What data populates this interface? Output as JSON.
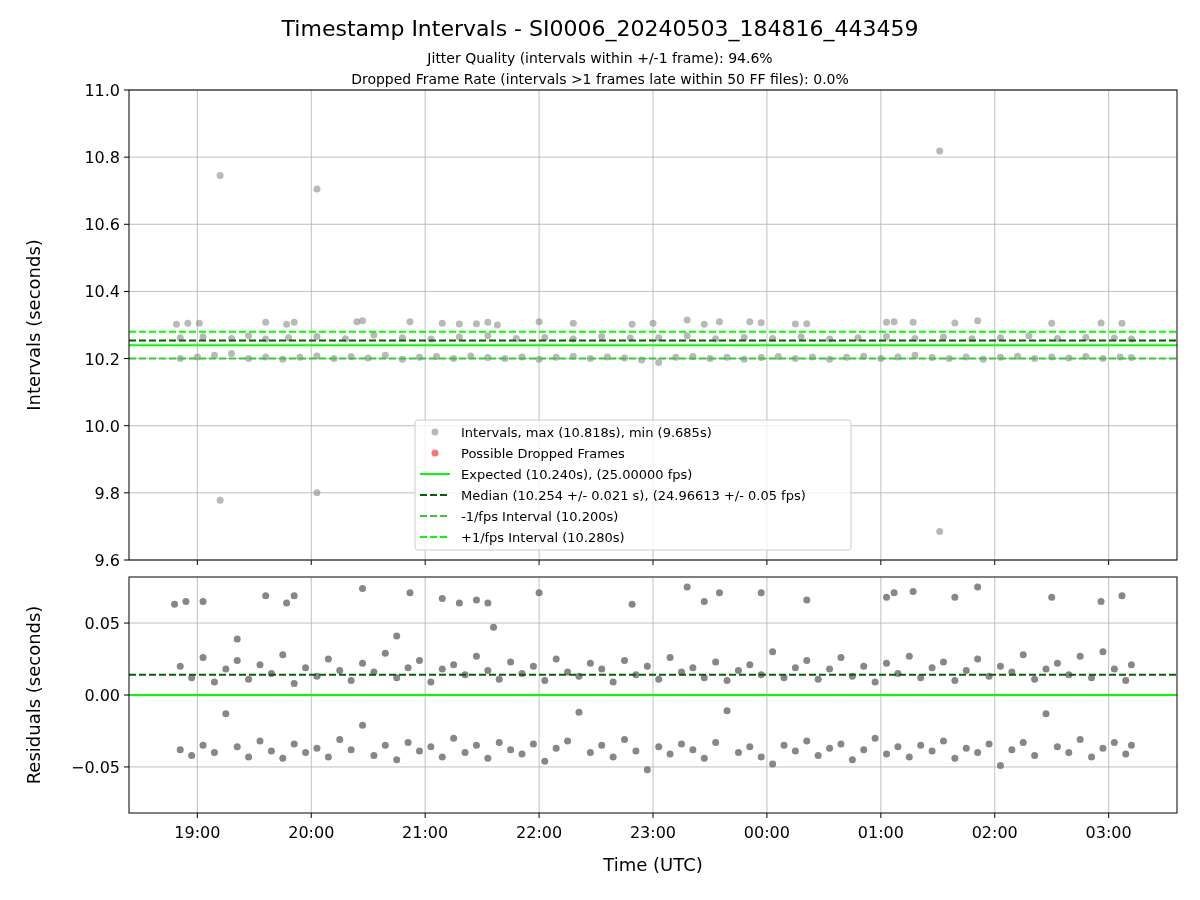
{
  "title": "Timestamp Intervals - SI0006_20240503_184816_443459",
  "subtitles": [
    "Jitter Quality (intervals within +/-1 frame): 94.6%",
    "Dropped Frame Rate (intervals >1 frames late within 50 FF files): 0.0%"
  ],
  "charts": [
    {
      "chart_data": {
        "type": "scatter",
        "ylabel": "Intervals (seconds)",
        "xlim": [
          "2024-05-03T18:24",
          "2024-05-04T03:36"
        ],
        "ylim": [
          9.6,
          11.0
        ],
        "grid": true,
        "legend": "lower center",
        "yticks": [
          {
            "value": 9.6,
            "label": "9.6"
          },
          {
            "value": 9.8,
            "label": "9.8"
          },
          {
            "value": 10.0,
            "label": "10.0"
          },
          {
            "value": 10.2,
            "label": "10.2"
          },
          {
            "value": 10.4,
            "label": "10.4"
          },
          {
            "value": 10.6,
            "label": "10.6"
          },
          {
            "value": 10.8,
            "label": "10.8"
          },
          {
            "value": 11.0,
            "label": "11.0"
          }
        ],
        "series": [
          {
            "name": "Intervals, max (10.818s), min (9.685s)",
            "color": "#808080",
            "x": [
              "2024-05-03T19:12",
              "2024-05-03T20:03",
              "2024-05-04T01:31",
              "2024-05-03T19:12",
              "2024-05-03T20:03",
              "2024-05-04T01:31",
              "2024-05-03T18:49",
              "2024-05-03T18:55",
              "2024-05-03T19:01",
              "2024-05-03T19:36",
              "2024-05-03T19:47",
              "2024-05-03T19:51",
              "2024-05-03T20:24",
              "2024-05-03T20:27",
              "2024-05-03T20:52",
              "2024-05-03T21:09",
              "2024-05-03T21:18",
              "2024-05-03T21:27",
              "2024-05-03T21:33",
              "2024-05-03T21:38",
              "2024-05-03T22:00",
              "2024-05-03T22:18",
              "2024-05-03T22:49",
              "2024-05-03T23:00",
              "2024-05-03T23:18",
              "2024-05-03T23:27",
              "2024-05-03T23:35",
              "2024-05-03T23:51",
              "2024-05-03T23:57",
              "2024-05-04T00:15",
              "2024-05-04T00:21",
              "2024-05-04T01:03",
              "2024-05-04T01:07",
              "2024-05-04T01:17",
              "2024-05-04T01:39",
              "2024-05-04T01:51",
              "2024-05-04T02:30",
              "2024-05-04T02:56",
              "2024-05-04T03:07",
              "2024-05-03T18:51",
              "2024-05-03T19:03",
              "2024-05-03T19:18",
              "2024-05-03T19:27",
              "2024-05-03T19:36",
              "2024-05-03T19:48",
              "2024-05-03T20:03",
              "2024-05-03T20:18",
              "2024-05-03T20:33",
              "2024-05-03T20:48",
              "2024-05-03T21:03",
              "2024-05-03T21:18",
              "2024-05-03T21:33",
              "2024-05-03T21:48",
              "2024-05-03T22:03",
              "2024-05-03T22:18",
              "2024-05-03T22:33",
              "2024-05-03T22:48",
              "2024-05-03T23:03",
              "2024-05-03T23:18",
              "2024-05-03T23:33",
              "2024-05-03T23:48",
              "2024-05-04T00:03",
              "2024-05-04T00:18",
              "2024-05-04T00:33",
              "2024-05-04T00:48",
              "2024-05-04T01:03",
              "2024-05-04T01:18",
              "2024-05-04T01:33",
              "2024-05-04T01:48",
              "2024-05-04T02:03",
              "2024-05-04T02:18",
              "2024-05-04T02:33",
              "2024-05-04T02:48",
              "2024-05-04T03:03",
              "2024-05-04T03:12",
              "2024-05-03T18:51",
              "2024-05-03T19:00",
              "2024-05-03T19:09",
              "2024-05-03T19:18",
              "2024-05-03T19:27",
              "2024-05-03T19:36",
              "2024-05-03T19:45",
              "2024-05-03T19:54",
              "2024-05-03T20:03",
              "2024-05-03T20:12",
              "2024-05-03T20:21",
              "2024-05-03T20:30",
              "2024-05-03T20:39",
              "2024-05-03T20:48",
              "2024-05-03T20:57",
              "2024-05-03T21:06",
              "2024-05-03T21:15",
              "2024-05-03T21:24",
              "2024-05-03T21:33",
              "2024-05-03T21:42",
              "2024-05-03T21:51",
              "2024-05-03T22:00",
              "2024-05-03T22:09",
              "2024-05-03T22:18",
              "2024-05-03T22:27",
              "2024-05-03T22:36",
              "2024-05-03T22:45",
              "2024-05-03T22:54",
              "2024-05-03T23:03",
              "2024-05-03T23:12",
              "2024-05-03T23:21",
              "2024-05-03T23:30",
              "2024-05-03T23:39",
              "2024-05-03T23:48",
              "2024-05-03T23:57",
              "2024-05-04T00:06",
              "2024-05-04T00:15",
              "2024-05-04T00:24",
              "2024-05-04T00:33",
              "2024-05-04T00:42",
              "2024-05-04T00:51",
              "2024-05-04T01:00",
              "2024-05-04T01:09",
              "2024-05-04T01:18",
              "2024-05-04T01:27",
              "2024-05-04T01:36",
              "2024-05-04T01:45",
              "2024-05-04T01:54",
              "2024-05-04T02:03",
              "2024-05-04T02:12",
              "2024-05-04T02:21",
              "2024-05-04T02:30",
              "2024-05-04T02:39",
              "2024-05-04T02:48",
              "2024-05-04T02:57",
              "2024-05-04T03:06",
              "2024-05-04T03:12"
            ],
            "values": [
              10.745,
              10.705,
              10.818,
              9.778,
              9.8,
              9.685,
              10.302,
              10.305,
              10.305,
              10.308,
              10.302,
              10.308,
              10.31,
              10.313,
              10.31,
              10.305,
              10.303,
              10.304,
              10.308,
              10.3,
              10.31,
              10.305,
              10.302,
              10.305,
              10.315,
              10.302,
              10.31,
              10.31,
              10.307,
              10.303,
              10.304,
              10.308,
              10.31,
              10.308,
              10.306,
              10.313,
              10.305,
              10.306,
              10.305,
              10.262,
              10.265,
              10.26,
              10.268,
              10.258,
              10.262,
              10.266,
              10.259,
              10.27,
              10.262,
              10.258,
              10.264,
              10.268,
              10.26,
              10.263,
              10.258,
              10.266,
              10.261,
              10.262,
              10.268,
              10.259,
              10.263,
              10.26,
              10.265,
              10.258,
              10.262,
              10.266,
              10.26,
              10.264,
              10.259,
              10.262,
              10.268,
              10.26,
              10.263,
              10.261,
              10.258,
              10.2,
              10.205,
              10.21,
              10.215,
              10.2,
              10.205,
              10.198,
              10.204,
              10.208,
              10.2,
              10.206,
              10.202,
              10.21,
              10.198,
              10.204,
              10.206,
              10.2,
              10.208,
              10.203,
              10.2,
              10.205,
              10.198,
              10.204,
              10.207,
              10.2,
              10.205,
              10.202,
              10.196,
              10.188,
              10.204,
              10.206,
              10.2,
              10.204,
              10.198,
              10.203,
              10.206,
              10.2,
              10.205,
              10.198,
              10.204,
              10.207,
              10.2,
              10.205,
              10.21,
              10.203,
              10.2,
              10.205,
              10.198,
              10.204,
              10.207,
              10.2,
              10.205,
              10.202,
              10.206,
              10.2,
              10.205,
              10.203
            ]
          },
          {
            "name": "Possible Dropped Frames",
            "color": "#ff0000"
          }
        ],
        "ref_lines": [
          {
            "axis": "y",
            "value": 10.24,
            "label": "Expected (10.240s), (25.00000 fps)",
            "color": "#00ff00"
          },
          {
            "axis": "y",
            "value": 10.254,
            "label": "Median (10.254 +/- 0.021 s), (24.96613 +/- 0.05 fps)",
            "color": "#006400"
          },
          {
            "axis": "y",
            "value": 10.2,
            "label": "-1/fps Interval (10.200s)",
            "color": "#32cd32"
          },
          {
            "axis": "y",
            "value": 10.28,
            "label": "+1/fps Interval (10.280s)",
            "color": "#00ff00"
          }
        ]
      }
    },
    {
      "chart_data": {
        "type": "scatter",
        "xlabel": "Time (UTC)",
        "ylabel": "Residuals (seconds)",
        "xlim": [
          "2024-05-03T18:24",
          "2024-05-04T03:36"
        ],
        "ylim": [
          -0.082,
          0.082
        ],
        "xticks": [
          {
            "value": "2024-05-03T19:00",
            "label": "19:00"
          },
          {
            "value": "2024-05-03T20:00",
            "label": "20:00"
          },
          {
            "value": "2024-05-03T21:00",
            "label": "21:00"
          },
          {
            "value": "2024-05-03T22:00",
            "label": "22:00"
          },
          {
            "value": "2024-05-03T23:00",
            "label": "23:00"
          },
          {
            "value": "2024-05-04T00:00",
            "label": "00:00"
          },
          {
            "value": "2024-05-04T01:00",
            "label": "01:00"
          },
          {
            "value": "2024-05-04T02:00",
            "label": "02:00"
          },
          {
            "value": "2024-05-04T03:00",
            "label": "03:00"
          }
        ],
        "grid": true,
        "yticks": [
          {
            "value": -0.05,
            "label": "−0.05"
          },
          {
            "value": 0,
            "label": "0.00"
          },
          {
            "value": 0.05,
            "label": "0.05"
          }
        ],
        "series": [
          {
            "color": "#696969",
            "x": [
              "2024-05-03T18:48",
              "2024-05-03T18:54",
              "2024-05-03T19:03",
              "2024-05-03T19:36",
              "2024-05-03T19:47",
              "2024-05-03T19:51",
              "2024-05-03T20:27",
              "2024-05-03T20:52",
              "2024-05-03T21:09",
              "2024-05-03T21:18",
              "2024-05-03T21:27",
              "2024-05-03T21:33",
              "2024-05-03T22:00",
              "2024-05-03T22:49",
              "2024-05-03T23:18",
              "2024-05-03T23:27",
              "2024-05-03T23:35",
              "2024-05-03T23:57",
              "2024-05-04T00:21",
              "2024-05-04T01:03",
              "2024-05-04T01:07",
              "2024-05-04T01:17",
              "2024-05-04T01:39",
              "2024-05-04T01:51",
              "2024-05-04T02:30",
              "2024-05-04T02:56",
              "2024-05-04T03:07",
              "2024-05-03T21:36",
              "2024-05-03T19:21",
              "2024-05-03T20:45",
              "2024-05-03T18:51",
              "2024-05-03T18:57",
              "2024-05-03T19:03",
              "2024-05-03T19:09",
              "2024-05-03T19:15",
              "2024-05-03T19:21",
              "2024-05-03T19:27",
              "2024-05-03T19:33",
              "2024-05-03T19:39",
              "2024-05-03T19:45",
              "2024-05-03T19:51",
              "2024-05-03T19:57",
              "2024-05-03T20:03",
              "2024-05-03T20:09",
              "2024-05-03T20:15",
              "2024-05-03T20:21",
              "2024-05-03T20:27",
              "2024-05-03T20:33",
              "2024-05-03T20:39",
              "2024-05-03T20:45",
              "2024-05-03T20:51",
              "2024-05-03T20:57",
              "2024-05-03T21:03",
              "2024-05-03T21:09",
              "2024-05-03T21:15",
              "2024-05-03T21:21",
              "2024-05-03T21:27",
              "2024-05-03T21:33",
              "2024-05-03T21:39",
              "2024-05-03T21:45",
              "2024-05-03T21:51",
              "2024-05-03T21:57",
              "2024-05-03T22:03",
              "2024-05-03T22:09",
              "2024-05-03T22:15",
              "2024-05-03T22:21",
              "2024-05-03T22:27",
              "2024-05-03T22:33",
              "2024-05-03T22:39",
              "2024-05-03T22:45",
              "2024-05-03T22:51",
              "2024-05-03T22:57",
              "2024-05-03T23:03",
              "2024-05-03T23:09",
              "2024-05-03T23:15",
              "2024-05-03T23:21",
              "2024-05-03T23:27",
              "2024-05-03T23:33",
              "2024-05-03T23:39",
              "2024-05-03T23:45",
              "2024-05-03T23:51",
              "2024-05-03T23:57",
              "2024-05-04T00:03",
              "2024-05-04T00:09",
              "2024-05-04T00:15",
              "2024-05-04T00:21",
              "2024-05-04T00:27",
              "2024-05-04T00:33",
              "2024-05-04T00:39",
              "2024-05-04T00:45",
              "2024-05-04T00:51",
              "2024-05-04T00:57",
              "2024-05-04T01:03",
              "2024-05-04T01:09",
              "2024-05-04T01:15",
              "2024-05-04T01:21",
              "2024-05-04T01:27",
              "2024-05-04T01:33",
              "2024-05-04T01:39",
              "2024-05-04T01:45",
              "2024-05-04T01:51",
              "2024-05-04T01:57",
              "2024-05-04T02:03",
              "2024-05-04T02:09",
              "2024-05-04T02:15",
              "2024-05-04T02:21",
              "2024-05-04T02:27",
              "2024-05-04T02:33",
              "2024-05-04T02:39",
              "2024-05-04T02:45",
              "2024-05-04T02:51",
              "2024-05-04T02:57",
              "2024-05-04T03:03",
              "2024-05-04T03:09",
              "2024-05-04T03:12",
              "2024-05-03T18:51",
              "2024-05-03T18:57",
              "2024-05-03T19:03",
              "2024-05-03T19:09",
              "2024-05-03T19:15",
              "2024-05-03T19:21",
              "2024-05-03T19:27",
              "2024-05-03T19:33",
              "2024-05-03T19:39",
              "2024-05-03T19:45",
              "2024-05-03T19:51",
              "2024-05-03T19:57",
              "2024-05-03T20:03",
              "2024-05-03T20:09",
              "2024-05-03T20:15",
              "2024-05-03T20:21",
              "2024-05-03T20:27",
              "2024-05-03T20:33",
              "2024-05-03T20:39",
              "2024-05-03T20:45",
              "2024-05-03T20:51",
              "2024-05-03T20:57",
              "2024-05-03T21:03",
              "2024-05-03T21:09",
              "2024-05-03T21:15",
              "2024-05-03T21:21",
              "2024-05-03T21:27",
              "2024-05-03T21:33",
              "2024-05-03T21:39",
              "2024-05-03T21:45",
              "2024-05-03T21:51",
              "2024-05-03T21:57",
              "2024-05-03T22:03",
              "2024-05-03T22:09",
              "2024-05-03T22:15",
              "2024-05-03T22:21",
              "2024-05-03T22:27",
              "2024-05-03T22:33",
              "2024-05-03T22:39",
              "2024-05-03T22:45",
              "2024-05-03T22:51",
              "2024-05-03T22:57",
              "2024-05-03T23:03",
              "2024-05-03T23:09",
              "2024-05-03T23:15",
              "2024-05-03T23:21",
              "2024-05-03T23:27",
              "2024-05-03T23:33",
              "2024-05-03T23:39",
              "2024-05-03T23:45",
              "2024-05-03T23:51",
              "2024-05-03T23:57",
              "2024-05-04T00:03",
              "2024-05-04T00:09",
              "2024-05-04T00:15",
              "2024-05-04T00:21",
              "2024-05-04T00:27",
              "2024-05-04T00:33",
              "2024-05-04T00:39",
              "2024-05-04T00:45",
              "2024-05-04T00:51",
              "2024-05-04T00:57",
              "2024-05-04T01:03",
              "2024-05-04T01:09",
              "2024-05-04T01:15",
              "2024-05-04T01:21",
              "2024-05-04T01:27",
              "2024-05-04T01:33",
              "2024-05-04T01:39",
              "2024-05-04T01:45",
              "2024-05-04T01:51",
              "2024-05-04T01:57",
              "2024-05-04T02:03",
              "2024-05-04T02:09",
              "2024-05-04T02:15",
              "2024-05-04T02:21",
              "2024-05-04T02:27",
              "2024-05-04T02:33",
              "2024-05-04T02:39",
              "2024-05-04T02:45",
              "2024-05-04T02:51",
              "2024-05-04T02:57",
              "2024-05-04T03:03",
              "2024-05-04T03:09",
              "2024-05-04T03:12"
            ],
            "values": [
              0.063,
              0.065,
              0.065,
              0.069,
              0.064,
              0.069,
              0.074,
              0.071,
              0.067,
              0.064,
              0.066,
              0.064,
              0.071,
              0.063,
              0.075,
              0.065,
              0.071,
              0.071,
              0.066,
              0.068,
              0.071,
              0.072,
              0.068,
              0.075,
              0.068,
              0.065,
              0.069,
              0.047,
              0.039,
              0.041,
              0.02,
              0.012,
              0.026,
              0.009,
              0.018,
              0.024,
              0.011,
              0.021,
              0.015,
              0.028,
              0.008,
              0.019,
              0.013,
              0.025,
              0.017,
              0.01,
              0.022,
              0.016,
              0.029,
              0.012,
              0.019,
              0.024,
              0.009,
              0.018,
              0.021,
              0.014,
              0.027,
              0.017,
              0.011,
              0.023,
              0.015,
              0.02,
              0.01,
              0.025,
              0.016,
              0.013,
              0.022,
              0.018,
              0.009,
              0.024,
              0.014,
              0.02,
              0.011,
              0.026,
              0.016,
              0.019,
              0.012,
              0.023,
              0.01,
              0.017,
              0.021,
              0.014,
              0.03,
              0.012,
              0.019,
              0.024,
              0.011,
              0.018,
              0.026,
              0.013,
              0.02,
              0.009,
              0.022,
              0.015,
              0.027,
              0.012,
              0.019,
              0.023,
              0.01,
              0.017,
              0.025,
              0.013,
              0.02,
              0.016,
              0.028,
              0.011,
              0.018,
              0.022,
              0.014,
              0.027,
              0.012,
              0.03,
              0.018,
              0.01,
              0.021,
              -0.038,
              -0.042,
              -0.035,
              -0.04,
              -0.013,
              -0.036,
              -0.043,
              -0.032,
              -0.039,
              -0.044,
              -0.034,
              -0.04,
              -0.037,
              -0.043,
              -0.031,
              -0.038,
              -0.021,
              -0.042,
              -0.035,
              -0.045,
              -0.033,
              -0.039,
              -0.036,
              -0.043,
              -0.03,
              -0.04,
              -0.035,
              -0.044,
              -0.033,
              -0.038,
              -0.041,
              -0.034,
              -0.046,
              -0.037,
              -0.032,
              -0.012,
              -0.04,
              -0.035,
              -0.043,
              -0.031,
              -0.039,
              -0.052,
              -0.036,
              -0.041,
              -0.034,
              -0.038,
              -0.044,
              -0.033,
              -0.011,
              -0.04,
              -0.036,
              -0.043,
              -0.048,
              -0.035,
              -0.039,
              -0.032,
              -0.042,
              -0.037,
              -0.034,
              -0.045,
              -0.038,
              -0.03,
              -0.041,
              -0.036,
              -0.043,
              -0.035,
              -0.039,
              -0.032,
              -0.044,
              -0.037,
              -0.04,
              -0.034,
              -0.049,
              -0.038,
              -0.033,
              -0.042,
              -0.013,
              -0.036,
              -0.04,
              -0.031,
              -0.043,
              -0.037,
              -0.033,
              -0.041,
              -0.035
            ]
          }
        ],
        "ref_lines": [
          {
            "axis": "y",
            "value": 0,
            "color": "#00ff00"
          },
          {
            "axis": "y",
            "value": 0.014,
            "color": "#006400"
          }
        ]
      }
    }
  ]
}
